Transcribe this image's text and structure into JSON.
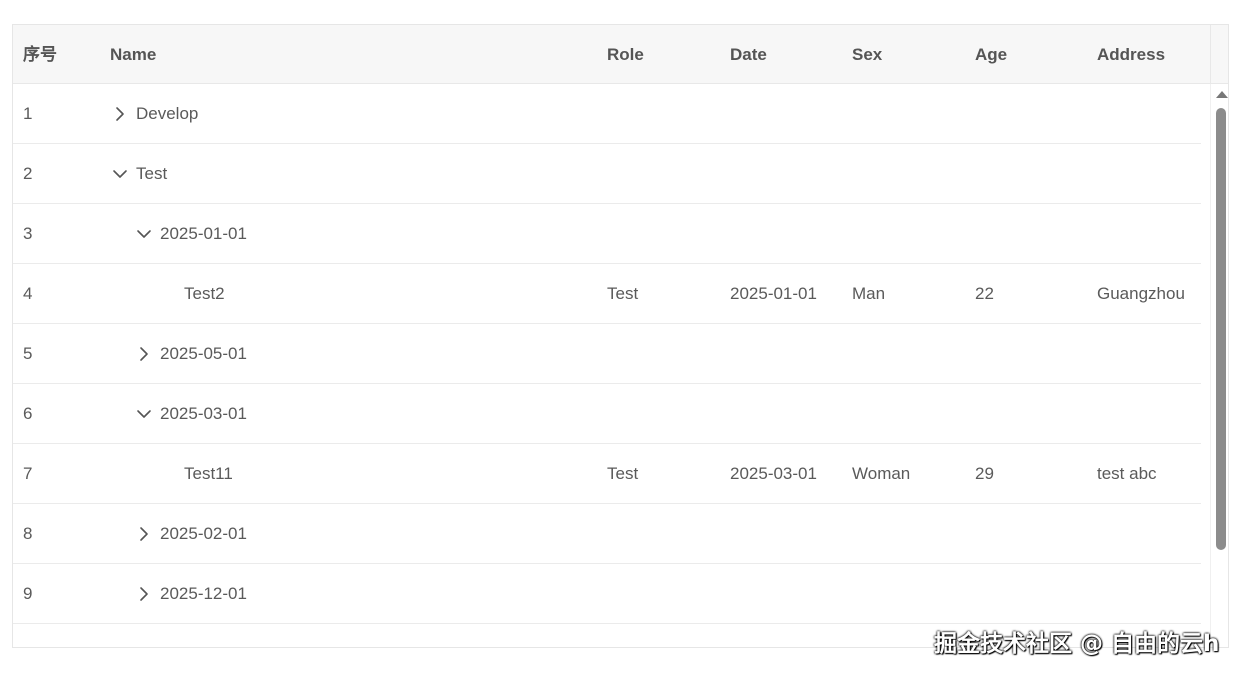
{
  "columns": {
    "index": "序号",
    "name": "Name",
    "role": "Role",
    "date": "Date",
    "sex": "Sex",
    "age": "Age",
    "address": "Address"
  },
  "rows": [
    {
      "index": "1",
      "name": "Develop",
      "level": 0,
      "toggle": "collapsed",
      "role": "",
      "date": "",
      "sex": "",
      "age": "",
      "address": ""
    },
    {
      "index": "2",
      "name": "Test",
      "level": 0,
      "toggle": "expanded",
      "role": "",
      "date": "",
      "sex": "",
      "age": "",
      "address": ""
    },
    {
      "index": "3",
      "name": "2025-01-01",
      "level": 1,
      "toggle": "expanded",
      "role": "",
      "date": "",
      "sex": "",
      "age": "",
      "address": ""
    },
    {
      "index": "4",
      "name": "Test2",
      "level": 2,
      "toggle": "none",
      "role": "Test",
      "date": "2025-01-01",
      "sex": "Man",
      "age": "22",
      "address": "Guangzhou"
    },
    {
      "index": "5",
      "name": "2025-05-01",
      "level": 1,
      "toggle": "collapsed",
      "role": "",
      "date": "",
      "sex": "",
      "age": "",
      "address": ""
    },
    {
      "index": "6",
      "name": "2025-03-01",
      "level": 1,
      "toggle": "expanded",
      "role": "",
      "date": "",
      "sex": "",
      "age": "",
      "address": ""
    },
    {
      "index": "7",
      "name": "Test11",
      "level": 2,
      "toggle": "none",
      "role": "Test",
      "date": "2025-03-01",
      "sex": "Woman",
      "age": "29",
      "address": "test abc"
    },
    {
      "index": "8",
      "name": "2025-02-01",
      "level": 1,
      "toggle": "collapsed",
      "role": "",
      "date": "",
      "sex": "",
      "age": "",
      "address": ""
    },
    {
      "index": "9",
      "name": "2025-12-01",
      "level": 1,
      "toggle": "collapsed",
      "role": "",
      "date": "",
      "sex": "",
      "age": "",
      "address": ""
    }
  ],
  "icons": {
    "collapsed": "chevron-right-icon",
    "expanded": "chevron-down-icon"
  },
  "watermark": "掘金技术社区 @ 自由的云h"
}
